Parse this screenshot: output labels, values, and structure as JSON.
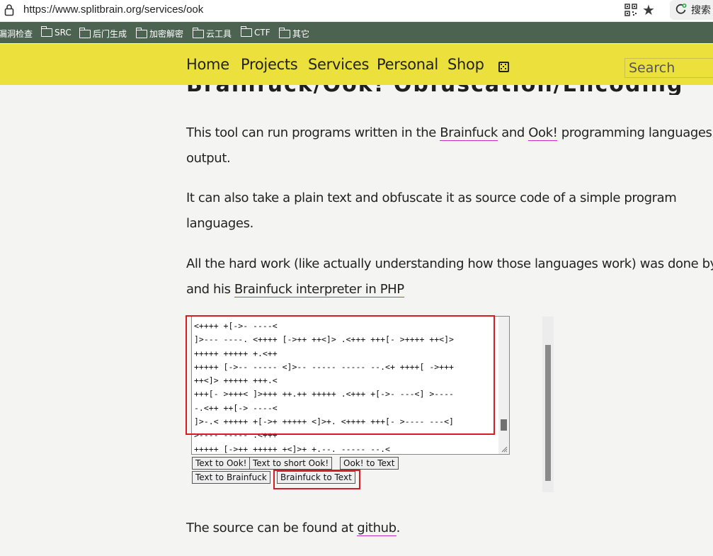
{
  "browser": {
    "url": "https://www.splitbrain.org/services/ook",
    "search_button_label": "搜索"
  },
  "bookmarks": [
    {
      "label": "漏洞检查",
      "folder": false
    },
    {
      "label": "SRC",
      "folder": true
    },
    {
      "label": "后门生成",
      "folder": true
    },
    {
      "label": "加密解密",
      "folder": true
    },
    {
      "label": "云工具",
      "folder": true
    },
    {
      "label": "CTF",
      "folder": true
    },
    {
      "label": "其它",
      "folder": true
    }
  ],
  "nav": {
    "items": [
      "Home",
      "Projects",
      "Services",
      "Personal",
      "Shop"
    ],
    "search_placeholder": "Search"
  },
  "page": {
    "heading": "Brainfuck/Ook! Obfuscation/Encoding",
    "p1": {
      "pre": "This tool can run programs written in the ",
      "link1": "Brainfuck",
      "mid": " and ",
      "link2": "Ook!",
      "post": " programming languages an",
      "line2": "output."
    },
    "p2": {
      "line1": "It can also take a plain text and obfuscate it as source code of a simple program",
      "line2": "languages."
    },
    "p3": {
      "line1": "All the hard work (like actually understanding how those languages work) was done by",
      "pre2": "and his ",
      "link": "Brainfuck interpreter in PHP"
    },
    "code_lines": [
      "<++++ +[->- ----<",
      "]>--- ----. <++++ [->++ ++<]> .<+++ +++[- >++++ ++<]>",
      "+++++ +++++ +.<++",
      "+++++ [->-- ----- <]>-- ----- ----- --.<+ ++++[ ->+++",
      "++<]> +++++ +++.<",
      "+++[- >+++< ]>+++ ++.++ +++++ .<+++ +[->- ---<] >----",
      "-.<++ ++[-> ----<",
      "]>-.< +++++ +[->+ +++++ <]>+. <++++ +++[- >---- ---<]",
      ">---- ----- .<+++",
      "+++++ [->++ +++++ +<]>+ +.--. ----- --.<"
    ],
    "buttons": {
      "text_to_ook": "Text to Ook!",
      "text_to_short_ook": "Text to short Ook!",
      "ook_to_text": "Ook! to Text",
      "text_to_brainfuck": "Text to Brainfuck",
      "brainfuck_to_text": "Brainfuck to Text"
    },
    "footer": {
      "pre": "The source can be found at ",
      "link": "github",
      "post": "."
    }
  },
  "colors": {
    "nav_bg": "#ece13c",
    "bookmarks_bg": "#4d6352",
    "link_underline": "#c22fc2",
    "annotation_red": "#d81c24"
  }
}
